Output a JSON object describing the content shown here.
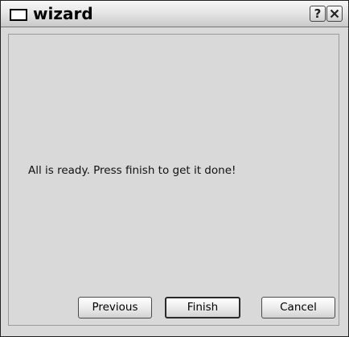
{
  "window": {
    "title": "wizard"
  },
  "titlebar": {
    "help_label": "?"
  },
  "content": {
    "message": "All is ready. Press finish to get it done!"
  },
  "buttons": {
    "previous": "Previous",
    "finish": "Finish",
    "cancel": "Cancel"
  },
  "icons": {
    "window_icon": "window-icon",
    "help": "help-icon",
    "close": "close-icon"
  }
}
